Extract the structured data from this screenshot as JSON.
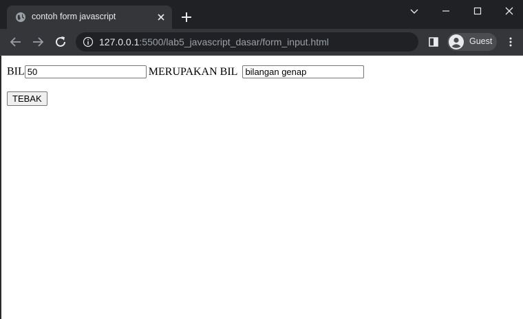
{
  "browser": {
    "tab_title": "contoh form javascript",
    "url_host": "127.0.0.1",
    "url_rest": ":5500/lab5_javascript_dasar/form_input.html",
    "profile_name": "Guest"
  },
  "form": {
    "bil_label": "BIL",
    "bil_value": "50",
    "merupakan_label": "MERUPAKAN BIL",
    "result_value": "bilangan genap",
    "tebak_button": "TEBAK"
  },
  "colors": {
    "tabstrip_bg": "#202124",
    "toolbar_bg": "#35363a",
    "omnibox_bg": "#202124",
    "text_light": "#e8eaed"
  },
  "icons": [
    "globe-icon",
    "close-icon",
    "plus-icon",
    "chevron-down-icon",
    "minimize-icon",
    "maximize-icon",
    "window-close-icon",
    "back-arrow-icon",
    "forward-arrow-icon",
    "reload-icon",
    "info-icon",
    "side-panel-icon",
    "avatar-icon",
    "kebab-menu-icon"
  ]
}
